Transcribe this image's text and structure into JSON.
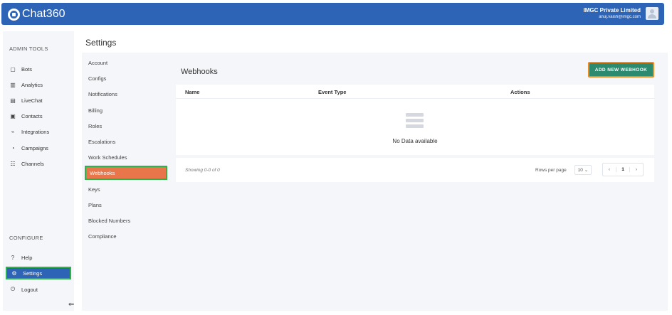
{
  "app": {
    "logo_text": "Chat360"
  },
  "account": {
    "org": "IMGC Private Limited",
    "email": "anuj.vaish@imgc.com"
  },
  "sidebar": {
    "admin_label": "ADMIN TOOLS",
    "items": [
      {
        "label": "Bots",
        "icon": "bot-icon"
      },
      {
        "label": "Analytics",
        "icon": "analytics-icon"
      },
      {
        "label": "LiveChat",
        "icon": "chat-icon"
      },
      {
        "label": "Contacts",
        "icon": "contacts-icon"
      },
      {
        "label": "Integrations",
        "icon": "plug-icon"
      },
      {
        "label": "Campaigns",
        "icon": "campaign-icon"
      },
      {
        "label": "Channels",
        "icon": "channels-icon"
      }
    ],
    "configure_label": "CONFIGURE",
    "config_items": [
      {
        "label": "Help",
        "icon": "help-icon"
      },
      {
        "label": "Settings",
        "icon": "gear-icon"
      },
      {
        "label": "Logout",
        "icon": "power-icon"
      }
    ],
    "collapse_glyph": "⇐"
  },
  "settings": {
    "title": "Settings",
    "menu": [
      "Account",
      "Configs",
      "Notifications",
      "Billing",
      "Roles",
      "Escalations",
      "Work Schedules",
      "Webhooks",
      "Keys",
      "Plans",
      "Blocked Numbers",
      "Compliance"
    ],
    "active": "Webhooks"
  },
  "main": {
    "title": "Webhooks",
    "add_button": "ADD NEW WEBHOOK",
    "columns": [
      "Name",
      "Event Type",
      "Actions"
    ],
    "empty_text": "No Data available",
    "showing": "Showing 0-0 of 0",
    "rows_per_page_label": "Rows per page",
    "rows_per_page_value": "10",
    "page": "1"
  },
  "colors": {
    "brand": "#2d64b5",
    "accent": "#2c8a6e",
    "active_menu": "#e8764a"
  }
}
